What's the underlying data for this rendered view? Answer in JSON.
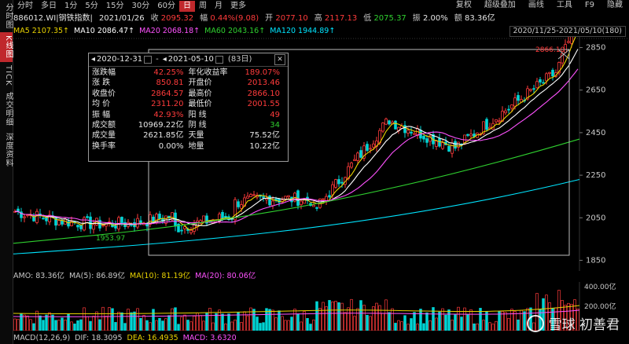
{
  "sidebar": [
    "分时图",
    "K线图",
    "TICK",
    "成交明细",
    "深度资料"
  ],
  "toolbar": {
    "periods": [
      "分时",
      "多日",
      "1分",
      "5分",
      "15分",
      "30分",
      "60分",
      "日",
      "周",
      "月",
      "更多"
    ],
    "active": "日",
    "right": [
      "复权",
      "超级叠加",
      "画线",
      "工具",
      "F9",
      "隐藏"
    ]
  },
  "info": {
    "code_name": "886012.WI|钢铁指数|",
    "date": "2021/01/26",
    "close_label": "收",
    "close": "2095.32",
    "change_label": "幅",
    "change": "0.44%(9.08)",
    "open_label": "开",
    "open": "2077.10",
    "high_label": "高",
    "high": "2117.13",
    "low_label": "低",
    "low": "2075.37",
    "amp_label": "振",
    "amp": "2.00%",
    "amount_label": "额",
    "amount": "83.36亿"
  },
  "ma": [
    {
      "label": "MA5",
      "value": "2107.35↑",
      "color": "#e8d200"
    },
    {
      "label": "MA10",
      "value": "2086.47↑",
      "color": "#ffffff"
    },
    {
      "label": "MA20",
      "value": "2068.18↑",
      "color": "#ff52ff"
    },
    {
      "label": "MA60",
      "value": "2043.16↑",
      "color": "#2fd02f"
    },
    {
      "label": "MA120",
      "value": "1944.89↑",
      "color": "#00e5ff"
    }
  ],
  "range_label": "2020/11/25-2021/05/10(180)",
  "popup": {
    "start": "2020-12-31",
    "sep": "-",
    "end": "2021-05-10",
    "days": "(83日)",
    "close": "✕",
    "left": [
      {
        "k": "涨跌幅",
        "v": "42.25%",
        "c": "red"
      },
      {
        "k": "涨  跌",
        "v": "850.81",
        "c": "red"
      },
      {
        "k": "收盘价",
        "v": "2864.57",
        "c": "red"
      },
      {
        "k": "均  价",
        "v": "2311.20",
        "c": "red"
      },
      {
        "k": "振  幅",
        "v": "42.93%",
        "c": "red"
      },
      {
        "k": "成交额",
        "v": "10969.22亿",
        "c": "white"
      },
      {
        "k": "成交量",
        "v": "2621.85亿",
        "c": "white"
      },
      {
        "k": "换手率",
        "v": "0.00%",
        "c": "white"
      }
    ],
    "right": [
      {
        "k": "年化收益率",
        "v": "189.07%",
        "c": "red"
      },
      {
        "k": "开盘价",
        "v": "2013.46",
        "c": "red"
      },
      {
        "k": "最高价",
        "v": "2866.10",
        "c": "red"
      },
      {
        "k": "最低价",
        "v": "2001.55",
        "c": "red"
      },
      {
        "k": "阳  线",
        "v": "49",
        "c": "red"
      },
      {
        "k": "阴  线",
        "v": "34",
        "c": "green"
      },
      {
        "k": "天量",
        "v": "75.52亿",
        "c": "white"
      },
      {
        "k": "地量",
        "v": "10.22亿",
        "c": "white"
      }
    ]
  },
  "y_ticks": [
    "2850",
    "2650",
    "2450",
    "2250",
    "2050",
    "1850"
  ],
  "low_label": "1953.97",
  "high_label": "2866.10",
  "amo": [
    {
      "t": "AMO: 83.36亿",
      "c": "#c8c8c8"
    },
    {
      "t": "MA(5): 86.89亿",
      "c": "#c8c8c8"
    },
    {
      "t": "MA(10): 81.19亿",
      "c": "#e8d200"
    },
    {
      "t": "MA(20): 80.06亿",
      "c": "#ff52ff"
    }
  ],
  "vol_ticks": [
    "400.00亿",
    "200.00亿"
  ],
  "macd": [
    {
      "t": "MACD(12,26,9)",
      "c": "#c8c8c8"
    },
    {
      "t": "DIF: 18.3095",
      "c": "#c8c8c8"
    },
    {
      "t": "DEA: 16.4935",
      "c": "#e8d200"
    },
    {
      "t": "MACD: 3.6320",
      "c": "#ff52ff"
    }
  ],
  "watermark": "雪球 初善君"
}
